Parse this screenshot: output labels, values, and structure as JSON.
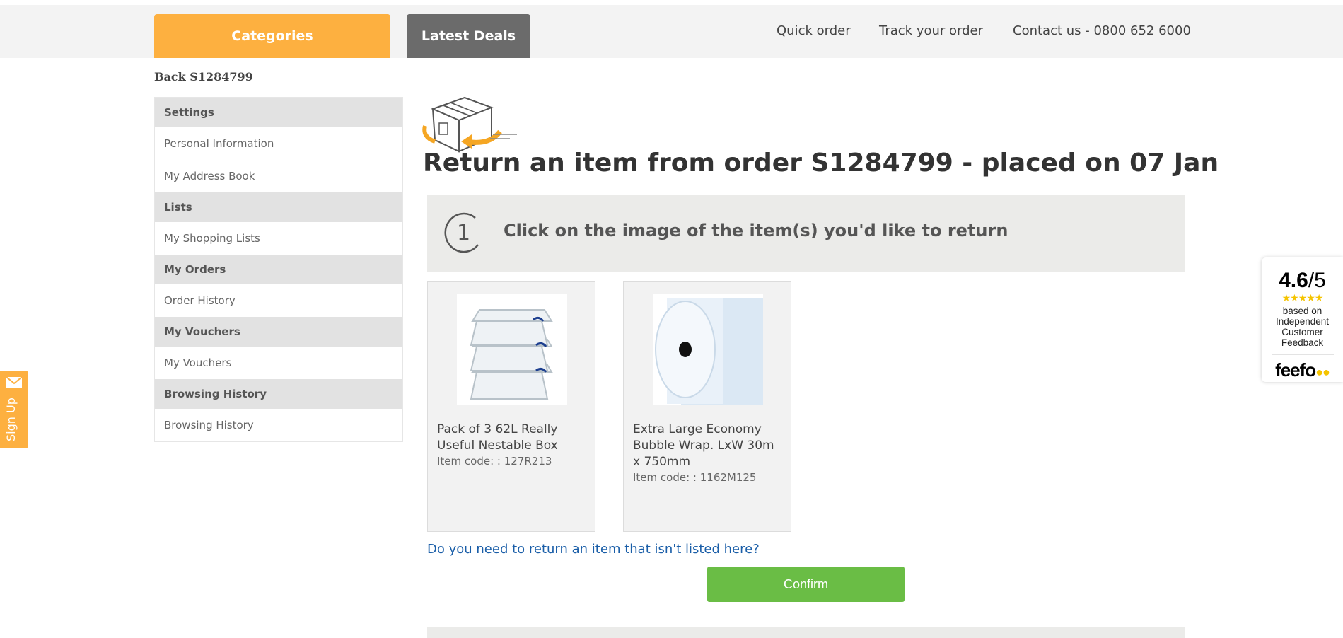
{
  "header": {
    "categories_label": "Categories",
    "deals_label": "Latest Deals",
    "quick_order": "Quick order",
    "track_order": "Track your order",
    "contact": "Contact us - 0800 652 6000"
  },
  "back_link": "Back S1284799",
  "sidebar": {
    "sections": [
      {
        "heading": "Settings",
        "items": [
          "Personal Information",
          "My Address Book"
        ]
      },
      {
        "heading": "Lists",
        "items": [
          "My Shopping Lists"
        ]
      },
      {
        "heading": "My Orders",
        "items": [
          "Order History"
        ]
      },
      {
        "heading": "My Vouchers",
        "items": [
          "My Vouchers"
        ]
      },
      {
        "heading": "Browsing History",
        "items": [
          "Browsing History"
        ]
      }
    ]
  },
  "signup_tab": "Sign Up",
  "page_title": "Return an item from order S1284799 - placed on 07 Jan",
  "step": {
    "number": "1",
    "text": "Click on the image of the item(s) you'd like to return"
  },
  "items": [
    {
      "name": "Pack of 3 62L Really Useful Nestable Box",
      "code": "Item code: : 127R213"
    },
    {
      "name": "Extra Large Economy Bubble Wrap. LxW 30m x 750mm",
      "code": "Item code: : 1162M125"
    }
  ],
  "not_listed_link": "Do you need to return an item that isn't listed here?",
  "confirm_label": "Confirm",
  "feefo": {
    "score": "4.6",
    "out_of": "/5",
    "stars": "★★★★★",
    "based_on": "based on Independent Customer Feedback",
    "logo": "feefo"
  },
  "colors": {
    "accent_orange": "#fdb040",
    "deals_grey": "#6b6b6b",
    "confirm_green": "#6abd45",
    "link_blue": "#1a5ea8"
  }
}
